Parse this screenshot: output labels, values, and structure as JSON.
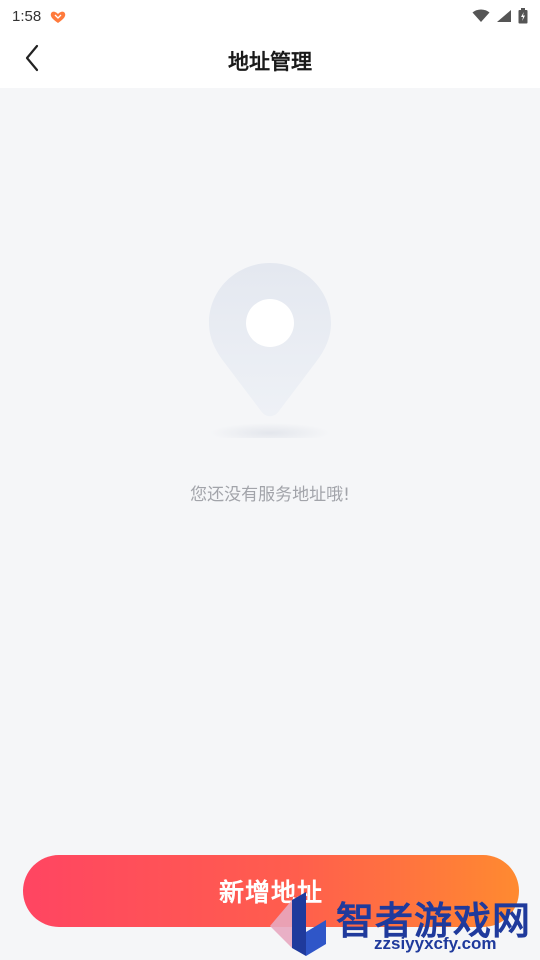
{
  "status_bar": {
    "time": "1:58",
    "app_icon": "heart-hands-icon",
    "icons": [
      "wifi-icon",
      "signal-icon",
      "battery-icon"
    ]
  },
  "nav": {
    "back_icon": "chevron-left-icon",
    "title": "地址管理"
  },
  "empty_state": {
    "illustration": "location-pin-icon",
    "message": "您还没有服务地址哦!"
  },
  "footer": {
    "add_button_label": "新增地址"
  },
  "watermark": {
    "title": "智者游戏网",
    "url": "zzsiyyxcfy.com"
  },
  "colors": {
    "accent_start": "#ff4562",
    "accent_end": "#ff8a30",
    "background": "#f5f6f8",
    "empty_text": "#a2a4aa"
  }
}
